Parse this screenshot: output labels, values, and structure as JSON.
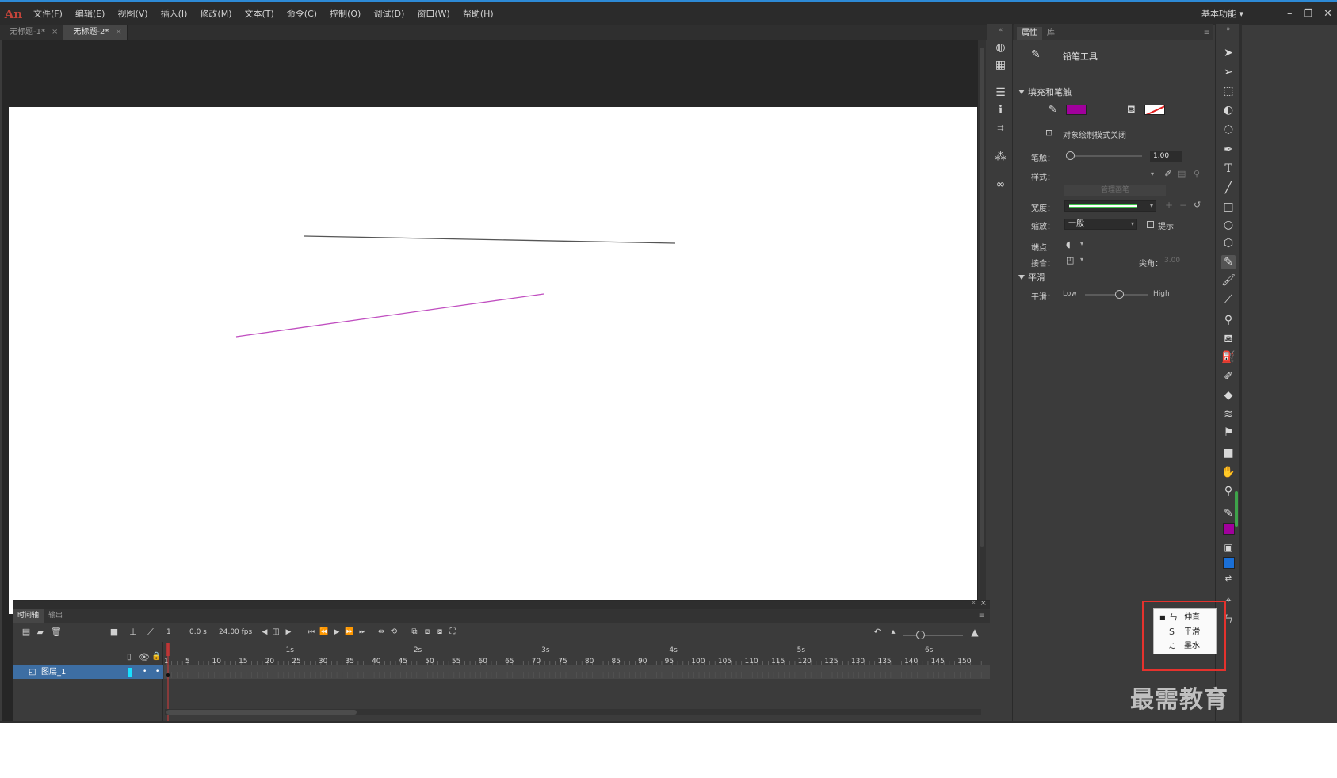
{
  "app": {
    "logo": "An",
    "menu": [
      "文件(F)",
      "编辑(E)",
      "视图(V)",
      "插入(I)",
      "修改(M)",
      "文本(T)",
      "命令(C)",
      "控制(O)",
      "调试(D)",
      "窗口(W)",
      "帮助(H)"
    ],
    "workspace": "基本功能",
    "window_buttons": [
      "–",
      "❐",
      "✕"
    ]
  },
  "doc_tabs": [
    {
      "label": "无标题-1*",
      "active": false
    },
    {
      "label": "无标题-2*",
      "active": true
    }
  ],
  "properties": {
    "tabs": [
      "属性",
      "库"
    ],
    "tool_name": "铅笔工具",
    "section_fill_stroke": "填充和笔触",
    "stroke_color": "#a1009c",
    "object_draw_mode": "对象绘制模式关闭",
    "stroke_label": "笔触：",
    "stroke_value": "1.00",
    "style_label": "样式：",
    "manage_brush": "管理画笔",
    "width_label": "宽度：",
    "scale_label": "缩放：",
    "scale_value": "一般",
    "hint_label": "提示",
    "cap_label": "端点：",
    "join_label": "接合：",
    "miter_label": "尖角：",
    "miter_value": "3.00",
    "section_smooth": "平滑",
    "smooth_label": "平滑：",
    "smooth_low": "Low",
    "smooth_high": "High",
    "smooth_level": 0.55
  },
  "tools": {
    "stroke_color": "#a1009c",
    "fill_color": "#1a6fd6"
  },
  "timeline": {
    "tabs": [
      "时间轴",
      "输出"
    ],
    "current_frame": "1",
    "time": "0.0 s",
    "fps": "24.00 fps",
    "seconds": [
      "1s",
      "2s",
      "3s",
      "4s",
      "5s",
      "6s"
    ],
    "frame_numbers": [
      "1",
      "5",
      "10",
      "15",
      "20",
      "25",
      "30",
      "35",
      "40",
      "45",
      "50",
      "55",
      "60",
      "65",
      "70",
      "75",
      "80",
      "85",
      "90",
      "95",
      "100",
      "105",
      "110",
      "115",
      "120",
      "125",
      "130",
      "135",
      "140",
      "145",
      "150"
    ],
    "layer_name": "图层_1"
  },
  "pencil_mode_popup": {
    "items": [
      {
        "label": "伸直",
        "icon": "straighten-icon",
        "selected": true
      },
      {
        "label": "平滑",
        "icon": "smooth-icon",
        "selected": false
      },
      {
        "label": "墨水",
        "icon": "ink-icon",
        "selected": false
      }
    ]
  },
  "watermark": "最需教育"
}
